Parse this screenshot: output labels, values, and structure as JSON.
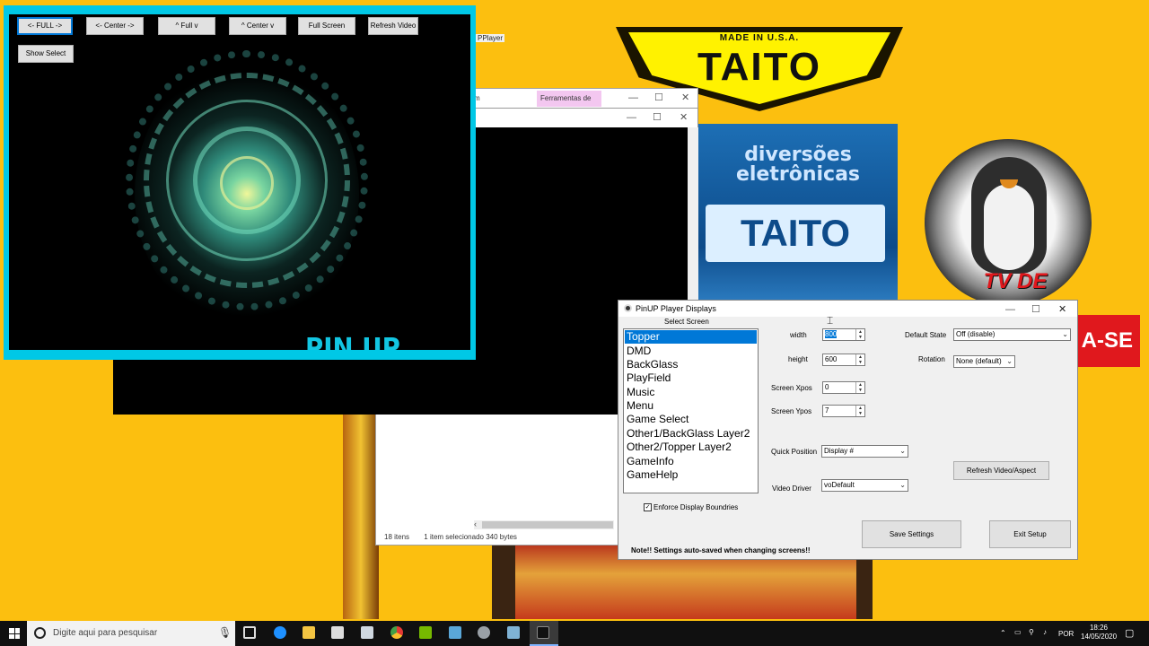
{
  "desktop": {
    "taito_made": "MADE IN U.S.A.",
    "taito_text": "TAITO",
    "diversoes_line1": "diversões",
    "diversoes_line2": "eletrônicas",
    "diversoes_taito": "TAITO",
    "tv_text": "TV DE",
    "banner_text": "A-SE",
    "hidden_tag": "PPlayer"
  },
  "explorer": {
    "tab_label": "Ferramentas de A...",
    "title_fragment": "m",
    "status_items": "18 itens",
    "status_selected": "1 item selecionado  340 bytes"
  },
  "player": {
    "buttons": [
      "<- FULL ->",
      "<- Center ->",
      "^ Full v",
      "^ Center v",
      "Full Screen",
      "Refresh Video"
    ],
    "show_select": "Show Select",
    "logo_text": "PIN UP PLAYER"
  },
  "dialog": {
    "title": "PinUP Player Displays",
    "select_screen_label": "Select Screen",
    "screens": [
      "Topper",
      "DMD",
      "BackGlass",
      "PlayField",
      "Music",
      "Menu",
      "Game Select",
      "Other1/BackGlass Layer2",
      "Other2/Topper Layer2",
      "GameInfo",
      "GameHelp"
    ],
    "selected_screen": "Topper",
    "width_label": "width",
    "width_value": "800",
    "height_label": "height",
    "height_value": "600",
    "xpos_label": "Screen Xpos",
    "xpos_value": "0",
    "ypos_label": "Screen Ypos",
    "ypos_value": "7",
    "default_state_label": "Default State",
    "default_state_value": "Off (disable)",
    "rotation_label": "Rotation",
    "rotation_value": "None (default)",
    "quick_position_label": "Quick Position",
    "quick_position_value": "Display #",
    "video_driver_label": "Video Driver",
    "video_driver_value": "voDefault",
    "refresh_button": "Refresh Video/Aspect",
    "enforce_label": "Enforce Display Boundries",
    "enforce_checked": true,
    "save_button": "Save Settings",
    "exit_button": "Exit Setup",
    "note": "Note!!  Settings auto-saved when changing screens!!"
  },
  "taskbar": {
    "search_placeholder": "Digite aqui para pesquisar",
    "language": "POR",
    "time": "18:26",
    "date": "14/05/2020"
  }
}
